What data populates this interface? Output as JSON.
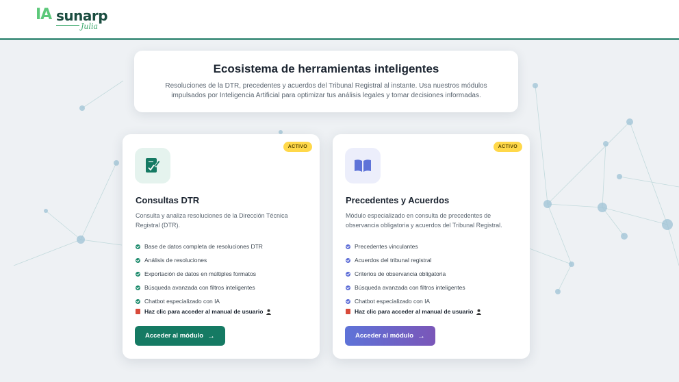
{
  "header": {
    "logo_ia": "IA",
    "logo_name": "sunarp",
    "logo_sub": "Julia"
  },
  "hero": {
    "title": "Ecosistema de herramientas inteligentes",
    "description": "Resoluciones de la DTR, precedentes y acuerdos del Tribunal Registral al instante. Usa nuestros módulos impulsados por Inteligencia Artificial para optimizar tus análisis legales y tomar decisiones informadas."
  },
  "cards": [
    {
      "badge": "ACTIVO",
      "icon": "document-edit-icon",
      "title": "Consultas DTR",
      "description": "Consulta y analiza resoluciones de la Dirección Técnica Registral (DTR).",
      "features": [
        "Base de datos completa de resoluciones DTR",
        "Análisis de resoluciones",
        "Exportación de datos en múltiples formatos",
        "Búsqueda avanzada con filtros inteligentes",
        "Chatbot especializado con IA"
      ],
      "manual_link": "Haz clic para acceder al manual de usuario",
      "button": "Acceder al módulo",
      "accent": "#157a63"
    },
    {
      "badge": "ACTIVO",
      "icon": "open-book-icon",
      "title": "Precedentes y Acuerdos",
      "description": "Módulo especializado en consulta de precedentes de observancia obligatoria y acuerdos del Tribunal Registral.",
      "features": [
        "Precedentes vinculantes",
        "Acuerdos del tribunal registral",
        "Criterios de observancia obligatoria",
        "Búsqueda avanzada con filtros inteligentes",
        "Chatbot especializado con IA"
      ],
      "manual_link": "Haz clic para acceder al manual de usuario",
      "button": "Acceder al módulo",
      "accent": "#5e73d8"
    }
  ],
  "colors": {
    "brand_green": "#157a63",
    "brand_blue": "#5e73d8",
    "badge_yellow": "#ffd84a"
  }
}
